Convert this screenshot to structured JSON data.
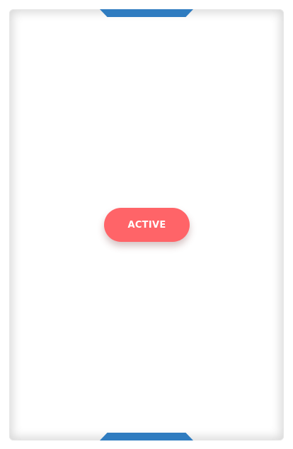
{
  "screen": {
    "frame_accent_color": "#2f7cc0",
    "primary_button": {
      "label": "ACTIVE",
      "background_color": "#ff6468",
      "text_color": "#ffffff"
    }
  }
}
